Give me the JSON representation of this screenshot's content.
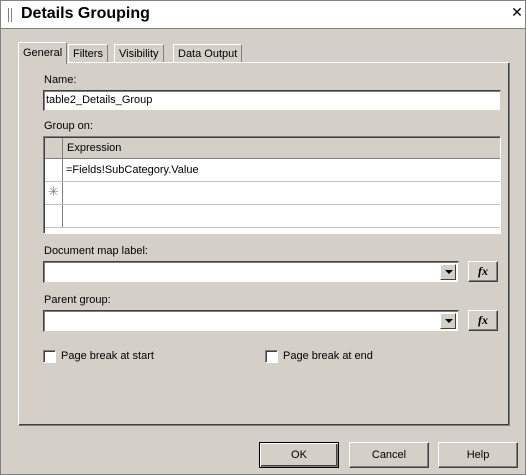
{
  "window": {
    "title": "Details Grouping",
    "close_glyph": "✕"
  },
  "tabs": [
    {
      "label": "General",
      "active": true
    },
    {
      "label": "Filters",
      "active": false
    },
    {
      "label": "Visibility",
      "active": false
    },
    {
      "label": "Data Output",
      "active": false
    }
  ],
  "general": {
    "name_label": "Name:",
    "name_value": "table2_Details_Group",
    "group_on_label": "Group on:",
    "grid": {
      "column_header": "Expression",
      "rows": [
        {
          "value": "=Fields!SubCategory.Value",
          "marker": ""
        },
        {
          "value": "",
          "marker": "✳"
        },
        {
          "value": "",
          "marker": ""
        }
      ]
    },
    "doc_map_label": "Document map label:",
    "doc_map_value": "",
    "parent_group_label": "Parent group:",
    "parent_group_value": "",
    "fx_label": "fx",
    "page_break_start_label": "Page break at start",
    "page_break_start_checked": false,
    "page_break_end_label": "Page break at end",
    "page_break_end_checked": false
  },
  "buttons": {
    "ok": "OK",
    "cancel": "Cancel",
    "help": "Help"
  },
  "colors": {
    "dialog_bg": "#d4d0c8",
    "title_bg": "#ffffff"
  },
  "icons": {
    "close": "close-icon",
    "dropdown": "chevron-down-icon",
    "expression": "function-icon",
    "new_row": "asterisk-icon"
  }
}
